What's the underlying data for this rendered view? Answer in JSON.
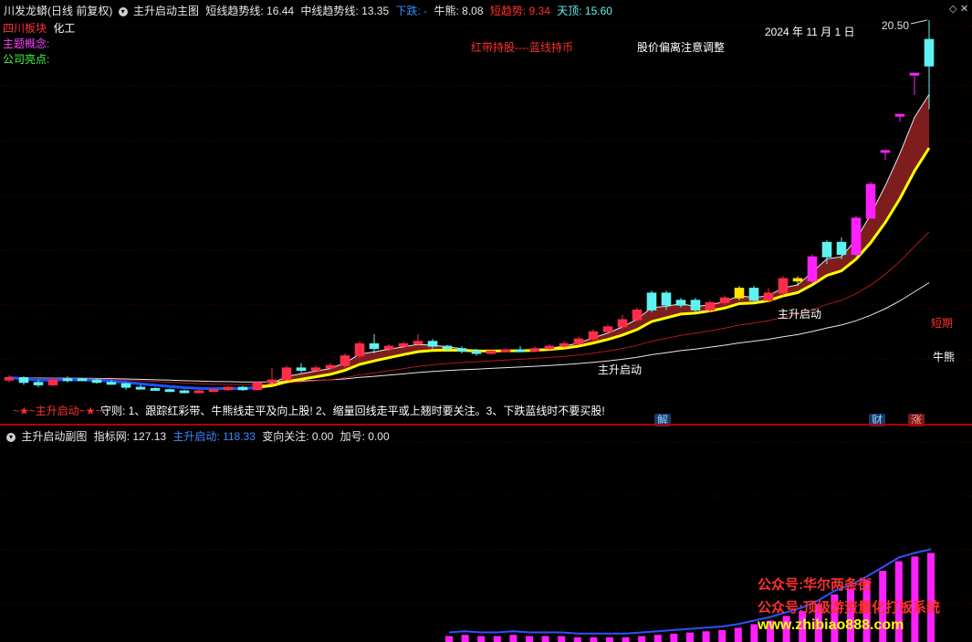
{
  "header": {
    "stock_name": "川发龙蟒(日线 前复权)",
    "main_indicator": "主升启动主图",
    "short_trend_label": "短线趋势线: 16.44",
    "mid_trend_label": "中线趋势线: 13.35",
    "fall_label": "下跌: -",
    "bull_bear_label": "牛熊: 8.08",
    "short_trend2_label": "短趋势: 9.34",
    "top_label": "天顶: 15.60"
  },
  "info": {
    "sector_label": "四川板块",
    "sector_value": "化工",
    "theme_label": "主题概念:",
    "highlight_label": "公司亮点:"
  },
  "annotations": {
    "legend_red_blue": "红带持股----蓝线持币",
    "price_deviation": "股价偏离注意调整",
    "date": "2024 年 11 月 1 日",
    "high_price": "20.50",
    "short_line": "短期",
    "bull_bear_line": "牛熊",
    "launch_mark": "主升启动",
    "rule_text": "守则: 1、跟踪红彩带、牛熊线走平及向上股! 2、缩量回线走平或上翘时要关注。3、下跌蓝线时不要买股!",
    "launch_signal": "~★~主升启动~★~"
  },
  "badges": {
    "jie": "解",
    "cai": "财",
    "zhang": "涨"
  },
  "sub_header": {
    "indicator_name": "主升启动副图",
    "index_label": "指标网: 127.13",
    "launch_label": "主升启动: 118.33",
    "turn_label": "变向关注: 0.00",
    "add_label": "加号: 0.00"
  },
  "watermark": {
    "line1": "公众号:华尔两条街",
    "line2": "公众号:顶级游资量化打板系统",
    "line3": "www.zhibiao888.com"
  },
  "colors": {
    "up": "#ff2c4a",
    "down": "#5ef2f2",
    "limit_up": "#ff20ff",
    "ribbon": "#8b2020",
    "yellow_line": "#ffff00",
    "blue_line": "#1a55ff",
    "short_line": "#b01818",
    "bull_bear_line": "#e8e8e8",
    "sub_bar": "#ff20ff"
  },
  "candles": [
    {
      "o": 5.6,
      "c": 5.7,
      "h": 5.8,
      "l": 5.5,
      "t": "u"
    },
    {
      "o": 5.7,
      "c": 5.5,
      "h": 5.75,
      "l": 5.4,
      "t": "d"
    },
    {
      "o": 5.5,
      "c": 5.4,
      "h": 5.6,
      "l": 5.3,
      "t": "d"
    },
    {
      "o": 5.4,
      "c": 5.6,
      "h": 5.7,
      "l": 5.35,
      "t": "u"
    },
    {
      "o": 5.6,
      "c": 5.65,
      "h": 5.75,
      "l": 5.5,
      "t": "d"
    },
    {
      "o": 5.65,
      "c": 5.6,
      "h": 5.7,
      "l": 5.55,
      "t": "d"
    },
    {
      "o": 5.6,
      "c": 5.5,
      "h": 5.65,
      "l": 5.45,
      "t": "d"
    },
    {
      "o": 5.5,
      "c": 5.45,
      "h": 5.6,
      "l": 5.4,
      "t": "d"
    },
    {
      "o": 5.45,
      "c": 5.3,
      "h": 5.5,
      "l": 5.2,
      "t": "d"
    },
    {
      "o": 5.3,
      "c": 5.25,
      "h": 5.4,
      "l": 5.2,
      "t": "d"
    },
    {
      "o": 5.25,
      "c": 5.2,
      "h": 5.3,
      "l": 5.15,
      "t": "d"
    },
    {
      "o": 5.2,
      "c": 5.15,
      "h": 5.25,
      "l": 5.1,
      "t": "d"
    },
    {
      "o": 5.15,
      "c": 5.1,
      "h": 5.2,
      "l": 5.05,
      "t": "d"
    },
    {
      "o": 5.1,
      "c": 5.15,
      "h": 5.2,
      "l": 5.05,
      "t": "u"
    },
    {
      "o": 5.15,
      "c": 5.2,
      "h": 5.25,
      "l": 5.1,
      "t": "u"
    },
    {
      "o": 5.2,
      "c": 5.3,
      "h": 5.35,
      "l": 5.15,
      "t": "u"
    },
    {
      "o": 5.3,
      "c": 5.2,
      "h": 5.35,
      "l": 5.15,
      "t": "d"
    },
    {
      "o": 5.2,
      "c": 5.5,
      "h": 5.55,
      "l": 5.2,
      "t": "u"
    },
    {
      "o": 5.5,
      "c": 5.6,
      "h": 6.1,
      "l": 5.5,
      "t": "u"
    },
    {
      "o": 5.6,
      "c": 6.1,
      "h": 6.2,
      "l": 5.6,
      "t": "u"
    },
    {
      "o": 6.1,
      "c": 6.0,
      "h": 6.3,
      "l": 5.9,
      "t": "d"
    },
    {
      "o": 6.0,
      "c": 6.1,
      "h": 6.2,
      "l": 5.95,
      "t": "u"
    },
    {
      "o": 6.1,
      "c": 6.2,
      "h": 6.3,
      "l": 6.05,
      "t": "u"
    },
    {
      "o": 6.2,
      "c": 6.6,
      "h": 6.7,
      "l": 6.1,
      "t": "u"
    },
    {
      "o": 6.6,
      "c": 7.1,
      "h": 7.2,
      "l": 6.5,
      "t": "u"
    },
    {
      "o": 7.1,
      "c": 6.9,
      "h": 7.5,
      "l": 6.7,
      "t": "d"
    },
    {
      "o": 6.9,
      "c": 7.0,
      "h": 7.1,
      "l": 6.8,
      "t": "u"
    },
    {
      "o": 7.0,
      "c": 7.1,
      "h": 7.2,
      "l": 6.9,
      "t": "u"
    },
    {
      "o": 7.1,
      "c": 7.2,
      "h": 7.5,
      "l": 7.0,
      "t": "u"
    },
    {
      "o": 7.2,
      "c": 7.0,
      "h": 7.3,
      "l": 6.9,
      "t": "d"
    },
    {
      "o": 7.0,
      "c": 6.9,
      "h": 7.05,
      "l": 6.8,
      "t": "d"
    },
    {
      "o": 6.9,
      "c": 6.8,
      "h": 7.0,
      "l": 6.7,
      "t": "d"
    },
    {
      "o": 6.8,
      "c": 6.7,
      "h": 6.9,
      "l": 6.6,
      "t": "d"
    },
    {
      "o": 6.7,
      "c": 6.8,
      "h": 6.85,
      "l": 6.65,
      "t": "u"
    },
    {
      "o": 6.8,
      "c": 6.85,
      "h": 6.9,
      "l": 6.75,
      "t": "u"
    },
    {
      "o": 6.85,
      "c": 6.8,
      "h": 7.0,
      "l": 6.75,
      "t": "d"
    },
    {
      "o": 6.8,
      "c": 6.9,
      "h": 7.0,
      "l": 6.75,
      "t": "u"
    },
    {
      "o": 6.9,
      "c": 7.0,
      "h": 7.1,
      "l": 6.85,
      "t": "u"
    },
    {
      "o": 7.0,
      "c": 7.1,
      "h": 7.2,
      "l": 6.95,
      "t": "u"
    },
    {
      "o": 7.1,
      "c": 7.3,
      "h": 7.4,
      "l": 7.05,
      "t": "u"
    },
    {
      "o": 7.3,
      "c": 7.6,
      "h": 7.7,
      "l": 7.2,
      "t": "u"
    },
    {
      "o": 7.6,
      "c": 7.8,
      "h": 7.9,
      "l": 7.5,
      "t": "u"
    },
    {
      "o": 7.8,
      "c": 8.1,
      "h": 8.3,
      "l": 7.7,
      "t": "u"
    },
    {
      "o": 8.1,
      "c": 8.5,
      "h": 8.6,
      "l": 8.0,
      "t": "u"
    },
    {
      "o": 8.5,
      "c": 9.2,
      "h": 9.3,
      "l": 8.4,
      "t": "d"
    },
    {
      "o": 9.2,
      "c": 8.7,
      "h": 9.3,
      "l": 8.5,
      "t": "d"
    },
    {
      "o": 8.7,
      "c": 8.9,
      "h": 9.0,
      "l": 8.6,
      "t": "d"
    },
    {
      "o": 8.9,
      "c": 8.5,
      "h": 9.0,
      "l": 8.4,
      "t": "d"
    },
    {
      "o": 8.5,
      "c": 8.8,
      "h": 8.9,
      "l": 8.4,
      "t": "u"
    },
    {
      "o": 8.8,
      "c": 9.0,
      "h": 9.1,
      "l": 8.7,
      "t": "u"
    },
    {
      "o": 9.0,
      "c": 9.4,
      "h": 9.5,
      "l": 8.9,
      "t": "y"
    },
    {
      "o": 9.4,
      "c": 8.9,
      "h": 9.5,
      "l": 8.8,
      "t": "d"
    },
    {
      "o": 8.9,
      "c": 9.2,
      "h": 9.4,
      "l": 8.8,
      "t": "u"
    },
    {
      "o": 9.2,
      "c": 9.8,
      "h": 9.9,
      "l": 9.1,
      "t": "u"
    },
    {
      "o": 9.8,
      "c": 9.7,
      "h": 9.9,
      "l": 9.5,
      "t": "y"
    },
    {
      "o": 9.7,
      "c": 10.7,
      "h": 10.8,
      "l": 9.6,
      "t": "p"
    },
    {
      "o": 10.7,
      "c": 11.3,
      "h": 11.4,
      "l": 10.4,
      "t": "d"
    },
    {
      "o": 11.3,
      "c": 10.8,
      "h": 11.5,
      "l": 10.6,
      "t": "d"
    },
    {
      "o": 10.8,
      "c": 12.3,
      "h": 12.4,
      "l": 10.7,
      "t": "p"
    },
    {
      "o": 12.3,
      "c": 13.7,
      "h": 13.8,
      "l": 12.3,
      "t": "p"
    },
    {
      "o": 15.1,
      "c": 15.1,
      "h": 15.1,
      "l": 14.7,
      "t": "p"
    },
    {
      "o": 16.6,
      "c": 16.6,
      "h": 16.6,
      "l": 16.3,
      "t": "p"
    },
    {
      "o": 18.3,
      "c": 18.3,
      "h": 18.3,
      "l": 17.4,
      "t": "p"
    },
    {
      "o": 19.7,
      "c": 18.6,
      "h": 20.5,
      "l": 16.8,
      "t": "d"
    }
  ],
  "sub_bars": [
    0.05,
    0.06,
    0.05,
    0.05,
    0.06,
    0.05,
    0.05,
    0.05,
    0.04,
    0.04,
    0.04,
    0.04,
    0.05,
    0.06,
    0.07,
    0.08,
    0.09,
    0.1,
    0.12,
    0.15,
    0.18,
    0.22,
    0.26,
    0.32,
    0.4,
    0.45,
    0.52,
    0.6,
    0.68,
    0.72,
    0.75
  ]
}
